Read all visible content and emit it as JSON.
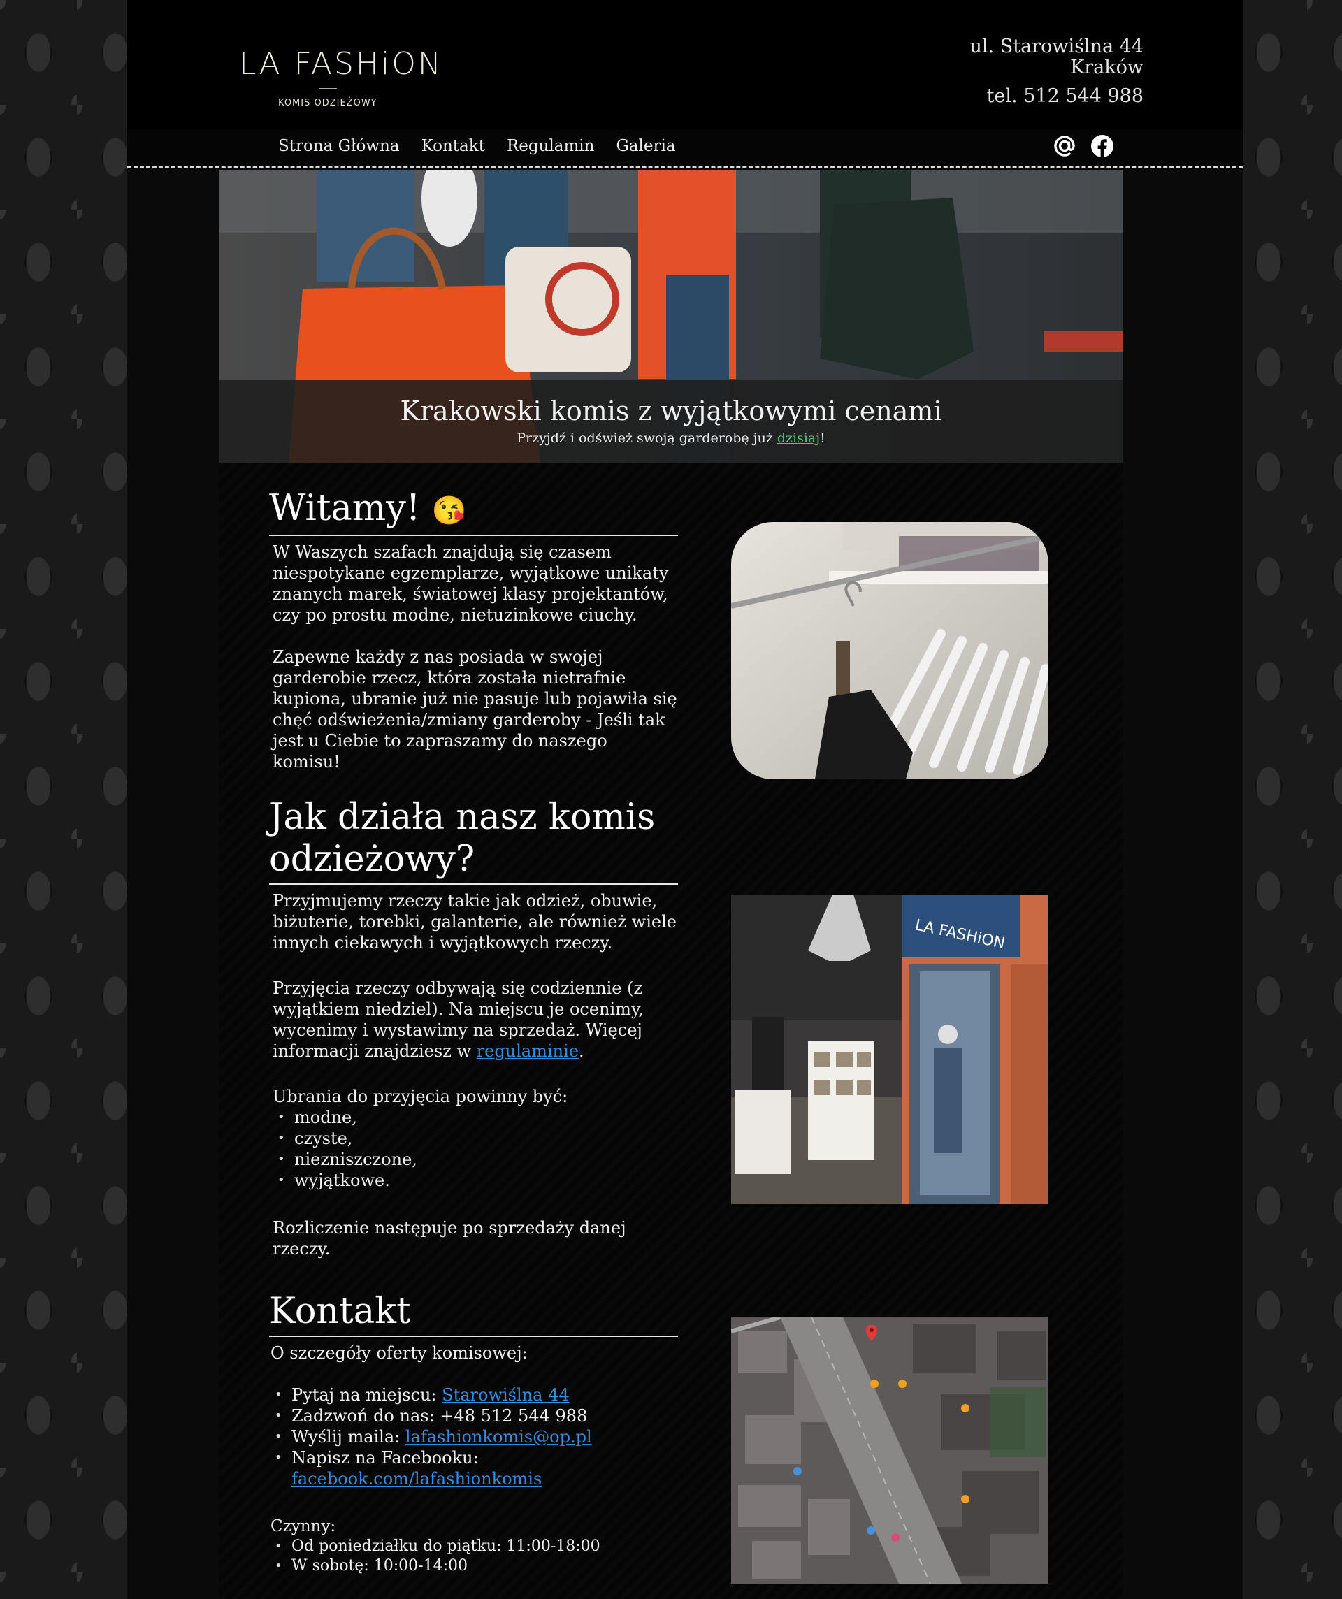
{
  "logo": {
    "name": "LA FASHiON",
    "tagline": "KOMIS ODZIEŻOWY"
  },
  "header": {
    "address_line1": "ul. Starowiślna 44",
    "address_line2": "Kraków",
    "phone": "tel. 512 544 988"
  },
  "nav": {
    "items": [
      {
        "label": "Strona Główna"
      },
      {
        "label": "Kontakt"
      },
      {
        "label": "Regulamin"
      },
      {
        "label": "Galeria"
      }
    ],
    "social_icons": [
      "at-icon",
      "facebook-icon"
    ]
  },
  "hero": {
    "title": "Krakowski komis z wyjątkowymi cenami",
    "subtitle_before": "Przyjdź i odśwież swoją garderobę już ",
    "subtitle_link": "dzisiaj",
    "subtitle_after": "!"
  },
  "welcome": {
    "heading": "Witamy!",
    "emoji": "😘",
    "p1": "W Waszych szafach znajdują się czasem niespotykane egzemplarze, wyjątkowe unikaty znanych marek, światowej klasy projektantów, czy po prostu modne, nietuzinkowe ciuchy.",
    "p2": "Zapewne każdy z nas posiada w swojej garderobie rzecz, która została nietrafnie kupiona, ubranie już nie pasuje lub pojawiła się chęć odświeżenia/zmiany garderoby - Jeśli tak jest u Ciebie to zapraszamy do naszego komisu!"
  },
  "how": {
    "heading": "Jak działa nasz komis odzieżowy?",
    "p1": "Przyjmujemy rzeczy takie jak odzież, obuwie, biżuterie, torebki, galanterie, ale również wiele innych ciekawych i wyjątkowych rzeczy.",
    "p2_before": "Przyjęcia rzeczy odbywają się codziennie (z wyjątkiem niedziel). Na miejscu je ocenimy, wycenimy i wystawimy na sprzedaż. Więcej informacji znajdziesz w ",
    "p2_link": "regulaminie",
    "p2_after": ".",
    "list_intro": "Ubrania do przyjęcia powinny być:",
    "list": [
      "modne,",
      "czyste,",
      "niezniszczone,",
      "wyjątkowe."
    ],
    "p3": "Rozliczenie następuje po sprzedaży danej rzeczy."
  },
  "contact": {
    "heading": "Kontakt",
    "intro": "O szczegóły oferty komisowej:",
    "item1_label": "Pytaj na miejscu: ",
    "item1_link": "Starowiślna 44",
    "item2": "Zadzwoń do nas: +48 512 544 988",
    "item3_label": "Wyślij maila: ",
    "item3_link": "lafashionkomis@op.pl",
    "item4_label": "Napisz na Facebooku:",
    "item4_link": "facebook.com/lafashionkomis",
    "hours_label": "Czynny:",
    "hours": [
      "Od poniedziałku do piątku: 11:00-18:00",
      "W sobotę: 10:00-14:00"
    ]
  },
  "colors": {
    "link": "#2d8fe6",
    "hero_link": "#4fd06a",
    "page_bg": "#0a0a0a"
  }
}
